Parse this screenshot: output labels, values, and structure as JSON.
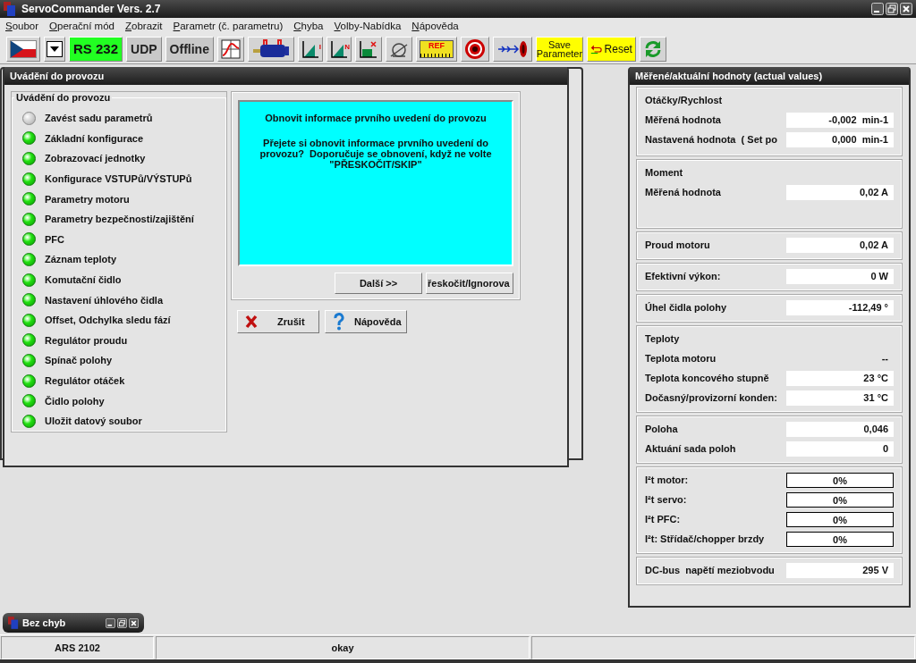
{
  "window": {
    "title": "ServoCommander Vers. 2.7"
  },
  "menu": [
    "Soubor",
    "Operační mód",
    "Zobrazit",
    "Parametr (č. parametru)",
    "Chyba",
    "Volby-Nabídka",
    "Nápověda"
  ],
  "toolbar": [
    {
      "kind": "flag"
    },
    {
      "kind": "dropdown"
    },
    {
      "kind": "toggle",
      "label": "RS 232",
      "active": true
    },
    {
      "kind": "toggle",
      "label": "UDP",
      "active": false
    },
    {
      "kind": "toggle",
      "label": "Offline",
      "active": false
    },
    {
      "kind": "stepchart"
    },
    {
      "kind": "motor"
    },
    {
      "kind": "graph",
      "label": "I"
    },
    {
      "kind": "graph",
      "label": "N"
    },
    {
      "kind": "crossgraph"
    },
    {
      "kind": "sensor"
    },
    {
      "kind": "ruler",
      "label": "REF"
    },
    {
      "kind": "target"
    },
    {
      "kind": "arrow"
    },
    {
      "kind": "yellow",
      "label": "Save Parameter"
    },
    {
      "kind": "reset",
      "label": "Reset"
    },
    {
      "kind": "refresh"
    }
  ],
  "commissioning": {
    "title": "Uvádění do provozu",
    "group_title": "Uvádění do provozu",
    "steps": [
      {
        "label": "Zavést sadu parametrů",
        "done": false
      },
      {
        "label": "Základní konfigurace",
        "done": true
      },
      {
        "label": "Zobrazovací jednotky",
        "done": true
      },
      {
        "label": "Konfigurace VSTUPů/VÝSTUPů",
        "done": true
      },
      {
        "label": "Parametry motoru",
        "done": true
      },
      {
        "label": "Parametry bezpečnosti/zajištění",
        "done": true
      },
      {
        "label": "PFC",
        "done": true
      },
      {
        "label": "Záznam teploty",
        "done": true
      },
      {
        "label": "Komutační čidlo",
        "done": true
      },
      {
        "label": "Nastavení úhlového čidla",
        "done": true
      },
      {
        "label": "Offset, Odchylka sledu fází",
        "done": true
      },
      {
        "label": "Regulátor proudu",
        "done": true
      },
      {
        "label": "Spínač polohy",
        "done": true
      },
      {
        "label": "Regulátor otáček",
        "done": true
      },
      {
        "label": "Čidlo polohy",
        "done": true
      },
      {
        "label": "Uložit datový soubor",
        "done": true
      }
    ],
    "message_title": "Obnovit informace prvního uvedení do provozu",
    "message_body": "Přejete si obnovit informace prvního uvedení do provozu?  Doporučuje se obnovení, když ne volte \"PŘESKOČIT/SKIP\"",
    "next_button": "Další >>",
    "skip_button": "řeskočit/Ignorova",
    "cancel_button": "Zrušit",
    "help_button": "Nápověda"
  },
  "actual_values": {
    "title": "Měřené/aktuální hodnoty (actual values)",
    "groups": [
      {
        "heading": "Otáčky/Rychlost",
        "rows": [
          {
            "label": "Měřená hodnota",
            "value": "-0,002  min-1",
            "kind": "field"
          },
          {
            "label": "Nastavená hodnota  ( Set po",
            "value": "0,000  min-1",
            "kind": "field"
          }
        ]
      },
      {
        "heading": "Moment",
        "rows": [
          {
            "label": "Měřená hodnota",
            "value": "0,02 A",
            "kind": "field"
          }
        ]
      },
      {
        "rows": [
          {
            "label": "Proud motoru",
            "value": "0,02 A",
            "kind": "field"
          }
        ]
      },
      {
        "rows": [
          {
            "label": "Efektivní výkon:",
            "value": "0 W",
            "kind": "field"
          }
        ]
      },
      {
        "rows": [
          {
            "label": "Úhel čidla polohy",
            "value": "-112,49 °",
            "kind": "field"
          }
        ]
      },
      {
        "heading": "Teploty",
        "rows": [
          {
            "label": "Teplota motoru",
            "value": "--",
            "kind": "plain"
          },
          {
            "label": "Teplota koncového stupně",
            "value": "23 °C",
            "kind": "field"
          },
          {
            "label": "Dočasný/provizorní konden:",
            "value": "31 °C",
            "kind": "field"
          }
        ]
      },
      {
        "rows": [
          {
            "label": "Poloha",
            "value": "0,046",
            "kind": "field"
          },
          {
            "label": "Aktuání sada poloh",
            "value": "0",
            "kind": "field"
          }
        ]
      },
      {
        "rows": [
          {
            "label": "I²t motor:",
            "value": "0%",
            "kind": "boxed"
          },
          {
            "label": "I²t servo:",
            "value": "0%",
            "kind": "boxed"
          },
          {
            "label": "I²t PFC:",
            "value": "0%",
            "kind": "boxed"
          },
          {
            "label": "I²t: Střídač/chopper brzdy",
            "value": "0%",
            "kind": "boxed"
          }
        ]
      },
      {
        "rows": [
          {
            "label": "DC-bus  napětí meziobvodu",
            "value": "295 V",
            "kind": "field"
          }
        ]
      }
    ]
  },
  "minimized_window": {
    "title": "Bez chyb"
  },
  "status_bar": [
    "ARS 2102",
    "okay"
  ]
}
